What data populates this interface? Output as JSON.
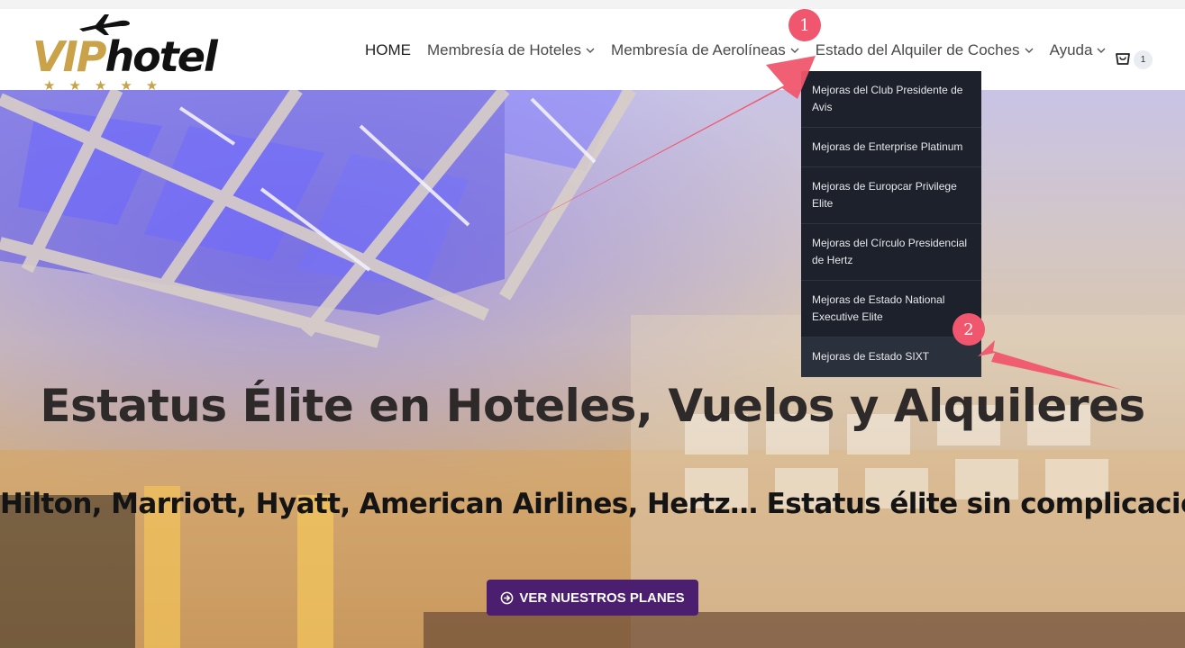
{
  "logo": {
    "part1": "VIP",
    "part2": "hotel",
    "stars": "★★★★★"
  },
  "nav": {
    "items": [
      {
        "label": "HOME"
      },
      {
        "label": "Membresía de Hoteles"
      },
      {
        "label": "Membresía de Aerolíneas"
      },
      {
        "label": "Estado del Alquiler de Coches"
      },
      {
        "label": "Ayuda"
      }
    ],
    "cart_count": "1"
  },
  "dropdown": {
    "items": [
      {
        "label": "Mejoras del Club Presidente de Avis"
      },
      {
        "label": "Mejoras de Enterprise Platinum"
      },
      {
        "label": "Mejoras de Europcar Privilege Elite"
      },
      {
        "label": "Mejoras del Círculo Presidencial de Hertz"
      },
      {
        "label": "Mejoras de Estado National Executive Elite"
      },
      {
        "label": "Mejoras de Estado SIXT"
      }
    ]
  },
  "hero": {
    "title": "Estatus Élite en Hoteles, Vuelos y Alquileres",
    "subtitle": "Hilton, Marriott, Hyatt, American Airlines, Hertz… Estatus élite sin complicaciones.",
    "cta_label": "VER NUESTROS PLANES"
  },
  "annotations": {
    "badge1": "1",
    "badge2": "2"
  },
  "colors": {
    "accent_gold": "#c9a24a",
    "cta_purple": "#4b1e70",
    "dropdown_bg": "#1c212b",
    "annotation_red": "#f0566d"
  }
}
